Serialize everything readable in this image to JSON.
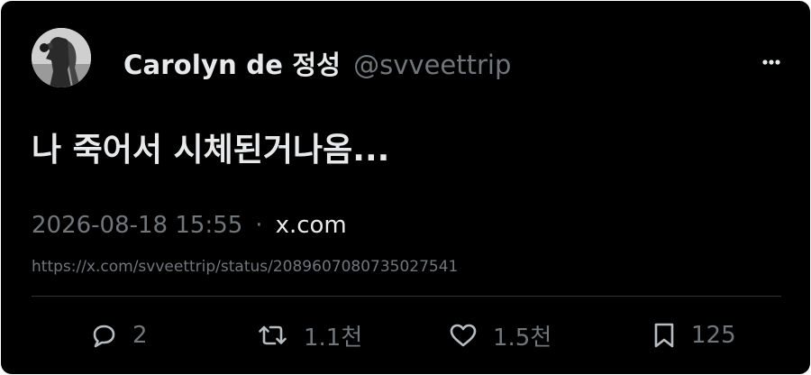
{
  "author": {
    "display_name": "Carolyn de 정성",
    "handle": "@svveettrip"
  },
  "tweet": {
    "text": "나 죽어서 시체된거나옴..."
  },
  "meta": {
    "timestamp": "2026-08-18 15:55",
    "separator": "·",
    "source": "x.com",
    "url": "https://x.com/svveettrip/status/2089607080735027541"
  },
  "actions": {
    "reply_count": "2",
    "retweet_count": "1.1천",
    "like_count": "1.5천",
    "bookmark_count": "125"
  },
  "icons": {
    "more": "more-horizontal-icon",
    "reply": "reply-bubble-icon",
    "retweet": "retweet-icon",
    "like": "heart-icon",
    "bookmark": "bookmark-icon"
  },
  "colors": {
    "background": "#000000",
    "primary_text": "#e7e9ea",
    "secondary_text": "#71767b",
    "divider": "#2f3336"
  }
}
